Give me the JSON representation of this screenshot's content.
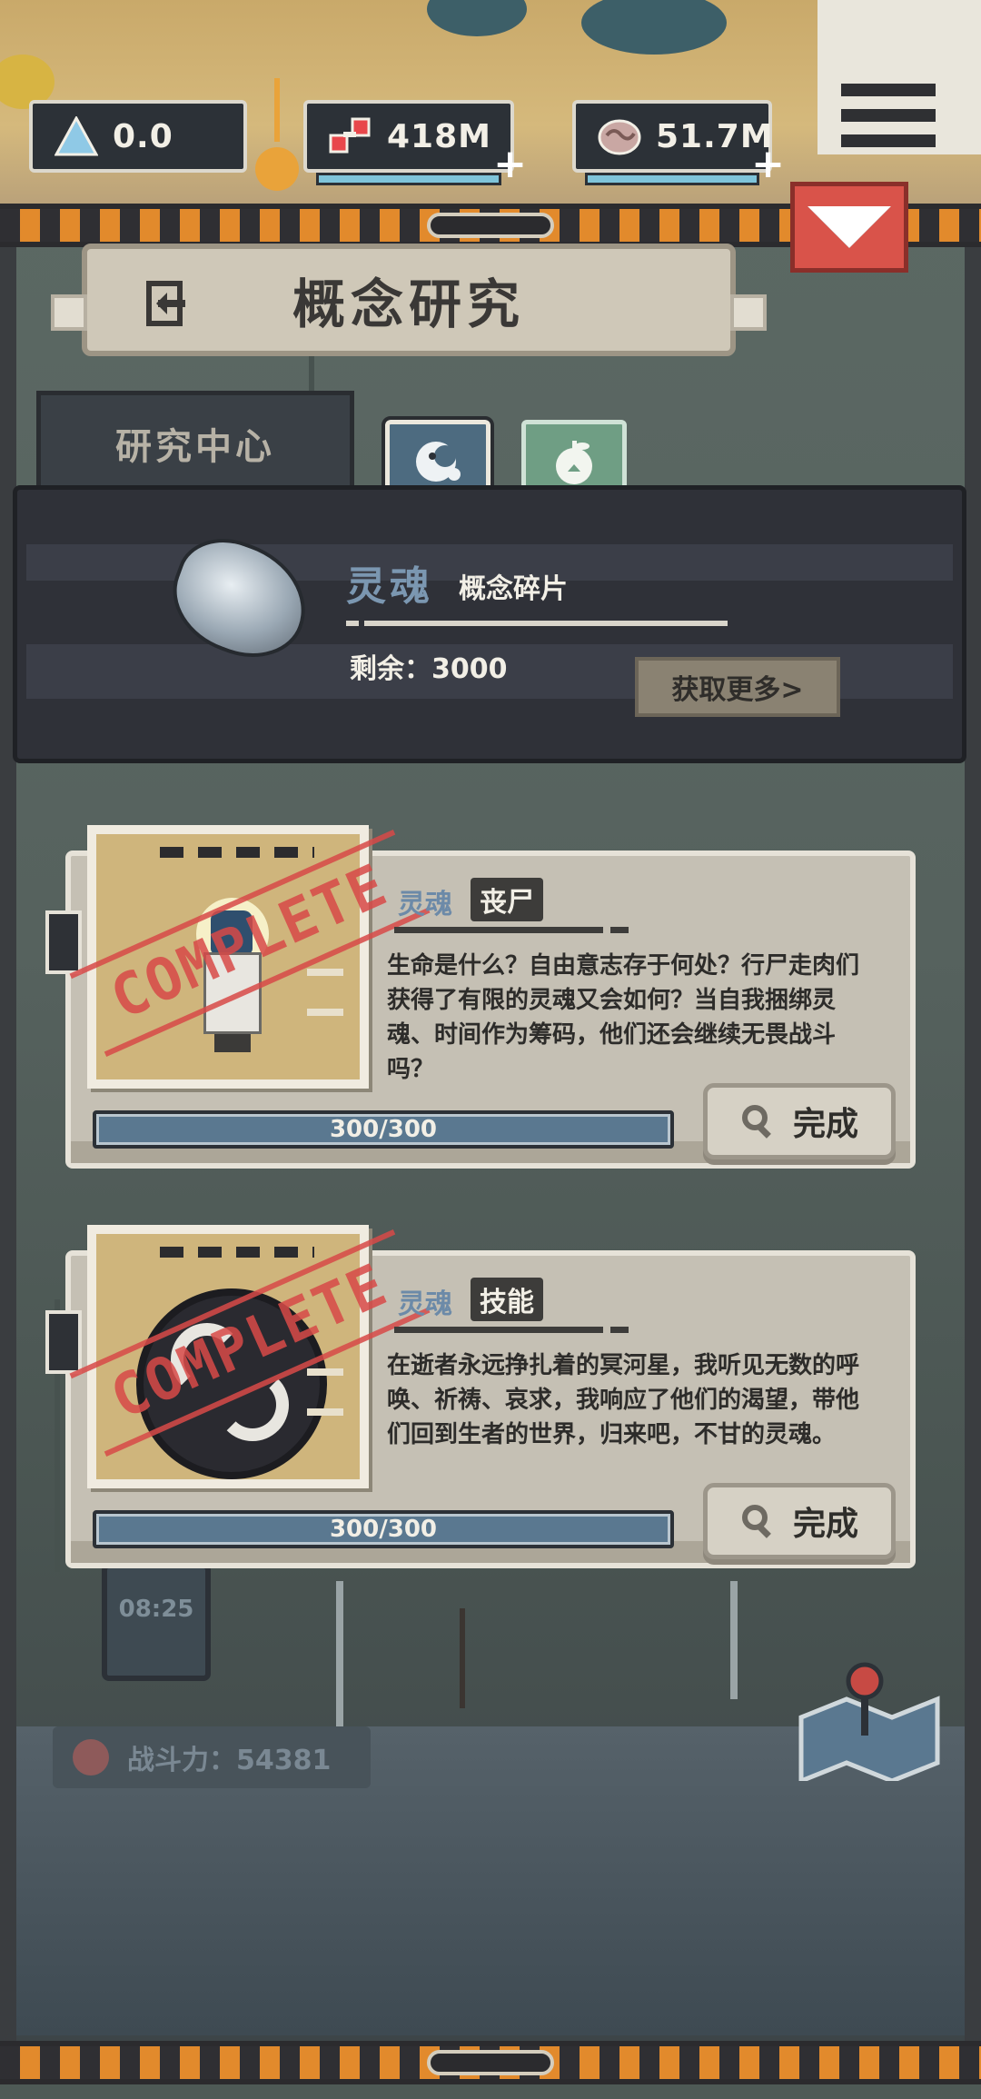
{
  "hud": {
    "stat_triangle": "0.0",
    "stat_gems": "418M",
    "stat_souls": "51.7M",
    "plus_label": "+"
  },
  "title": {
    "text": "概念研究"
  },
  "tabs": {
    "research_center": "研究中心"
  },
  "resource": {
    "name": "灵魂",
    "subtitle": "概念碎片",
    "remain": "剩余：3000",
    "get_more": "获取更多>"
  },
  "cards": [
    {
      "category": "灵魂",
      "name": "丧尸",
      "description": "生命是什么？自由意志存于何处？行尸走肉们获得了有限的灵魂又会如何？当自我捆绑灵魂、时间作为筹码，他们还会继续无畏战斗吗？",
      "stamp": "COMPLETE",
      "progress_text": "300/300",
      "progress": 1.0,
      "action": "完成"
    },
    {
      "category": "灵魂",
      "name": "技能",
      "description": "在逝者永远挣扎着的冥河星，我听见无数的呼唤、祈祷、哀求，我响应了他们的渴望，带他们回到生者的世界，归来吧，不甘的灵魂。",
      "stamp": "COMPLETE",
      "progress_text": "300/300",
      "progress": 1.0,
      "action": "完成"
    }
  ],
  "background": {
    "timer": "08:25",
    "power": "战斗力：54381"
  },
  "colors": {
    "accent_orange": "#e28a2c",
    "danger_red": "#d9534a",
    "soul_blue": "#7b97b1",
    "stamp_red": "#d84a48"
  }
}
